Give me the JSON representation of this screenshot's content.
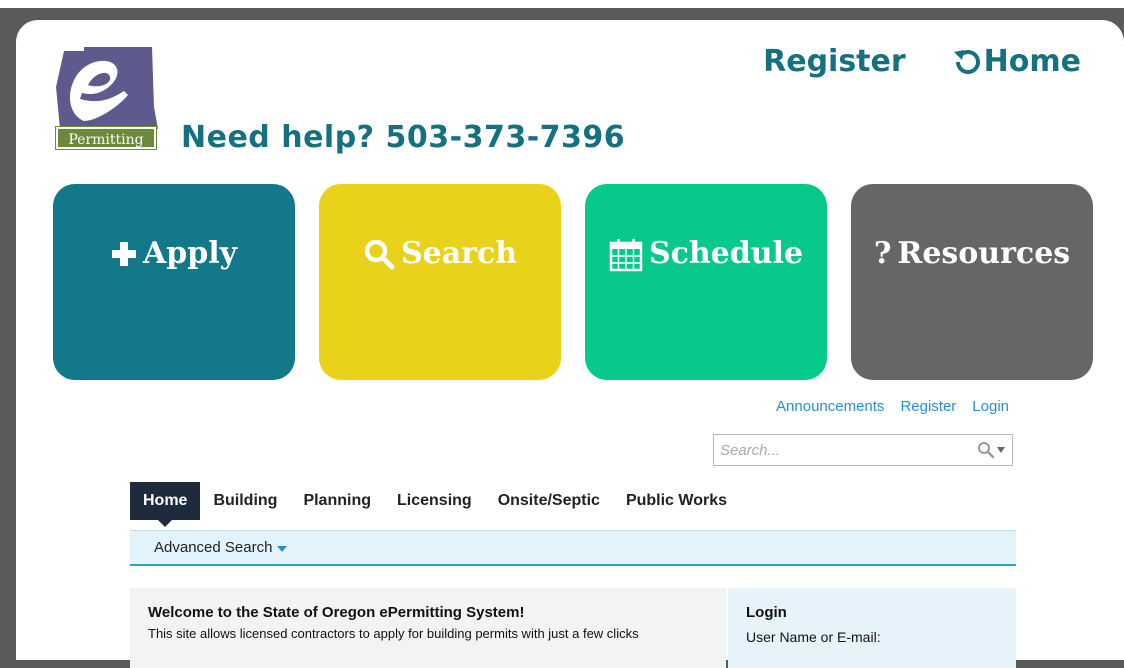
{
  "header": {
    "logo_text": "Permitting",
    "help_text": "Need help? 503-373-7396",
    "register_label": "Register",
    "home_label": "Home"
  },
  "tiles": {
    "apply": "Apply",
    "search": "Search",
    "schedule": "Schedule",
    "resources": "Resources"
  },
  "account_links": {
    "announcements": "Announcements",
    "register": "Register",
    "login": "Login"
  },
  "search": {
    "placeholder": "Search..."
  },
  "nav": {
    "tabs": [
      "Home",
      "Building",
      "Planning",
      "Licensing",
      "Onsite/Septic",
      "Public Works"
    ],
    "active": "Home",
    "advanced_search": "Advanced Search"
  },
  "welcome": {
    "title": "Welcome to the State of Oregon ePermitting System!",
    "text": "This site allows licensed contractors to apply for building permits with just a few clicks"
  },
  "login": {
    "title": "Login",
    "username_label": "User Name or E-mail:"
  },
  "colors": {
    "brand_teal": "#15717f",
    "apply": "#12788a",
    "search": "#e8d21a",
    "schedule": "#06c98b",
    "resources": "#666666",
    "link_blue": "#2a8fd0"
  },
  "icons": [
    "plus-icon",
    "search-icon",
    "calendar-icon",
    "question-icon",
    "home-refresh-icon",
    "search-dropdown-icon"
  ]
}
